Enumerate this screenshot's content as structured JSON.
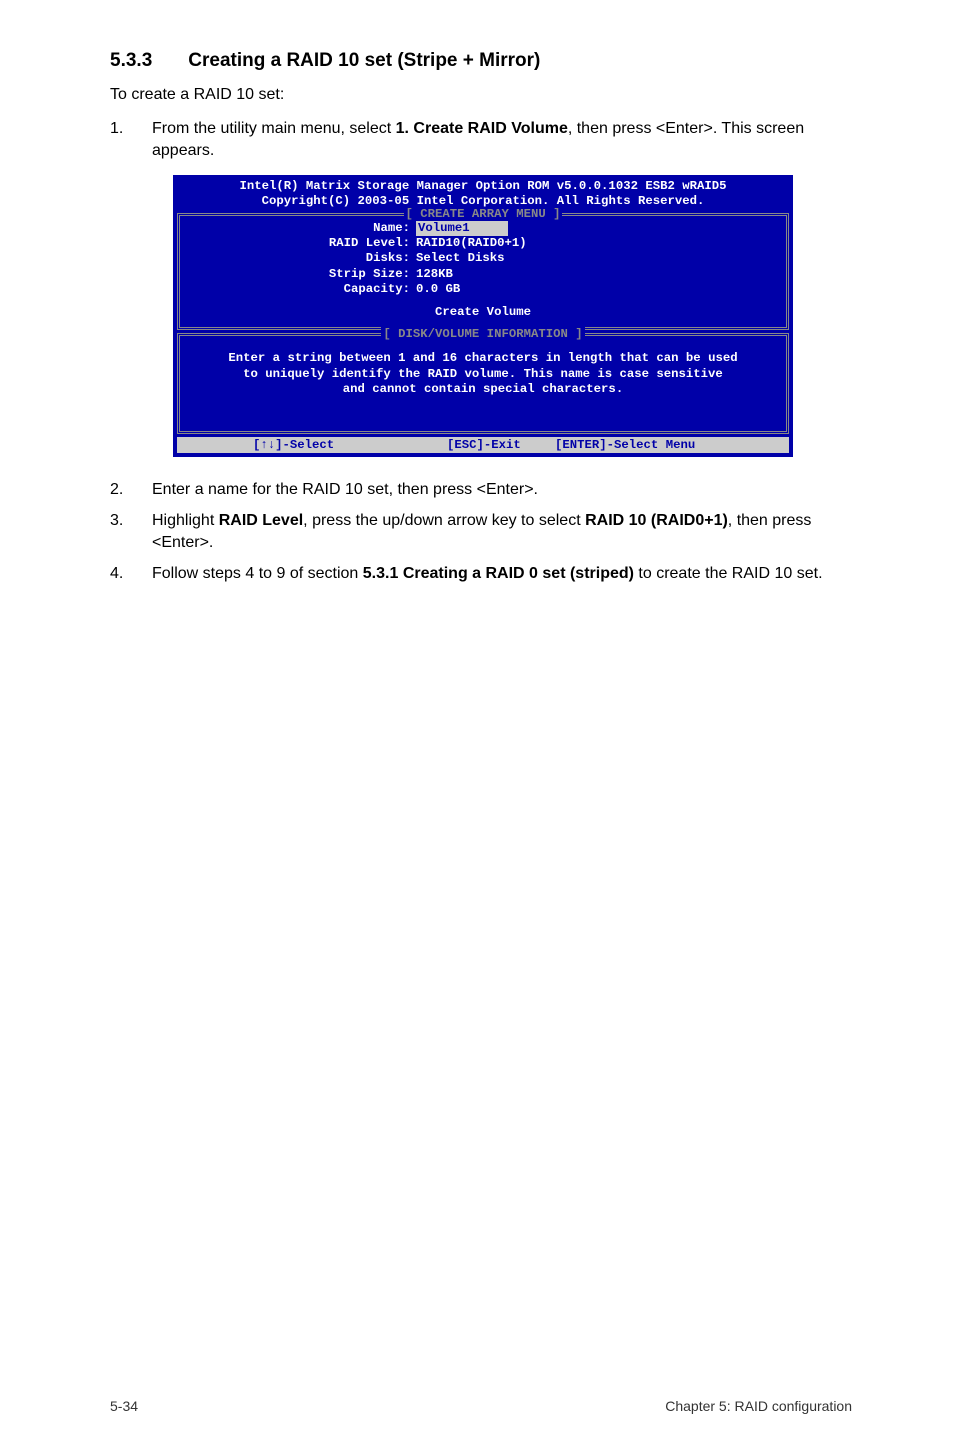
{
  "section": {
    "number": "5.3.3",
    "title": "Creating a RAID 10 set (Stripe + Mirror)"
  },
  "intro": "To create a RAID 10 set:",
  "steps": [
    {
      "num": "1.",
      "pre": "From the utility main menu, select ",
      "bold1": "1. Create RAID Volume",
      "post": ", then press <Enter>. This screen appears."
    },
    {
      "num": "2.",
      "pre": "Enter a name for the RAID 10  set, then press <Enter>.",
      "bold1": "",
      "post": ""
    },
    {
      "num": "3.",
      "pre": "Highlight ",
      "bold1": "RAID Level",
      "mid": ", press the up/down arrow key to select ",
      "bold2": "RAID 10 (RAID0+1)",
      "post": ", then press <Enter>."
    },
    {
      "num": "4.",
      "pre": "Follow steps 4 to 9 of section ",
      "bold1": "5.3.1 Creating a RAID 0 set (striped)",
      "post": " to create the RAID 10 set."
    }
  ],
  "bios": {
    "header1": "Intel(R) Matrix Storage Manager Option ROM v5.0.0.1032 ESB2 wRAID5",
    "header2": "Copyright(C) 2003-05 Intel Corporation. All Rights Reserved.",
    "frame1_title": "[ CREATE ARRAY MENU ]",
    "rows": {
      "name_label": "Name:",
      "name_value": "Volume1",
      "raid_label": "RAID Level:",
      "raid_value": "RAID10(RAID0+1)",
      "disks_label": "Disks:",
      "disks_value": "Select Disks",
      "strip_label": "Strip Size:",
      "strip_value": "128KB",
      "cap_label": "Capacity:",
      "cap_value": "0.0   GB"
    },
    "create_volume": "Create Volume",
    "frame2_title": "[ DISK/VOLUME INFORMATION ]",
    "info1": "Enter a string between 1 and 16 characters in length that can be used",
    "info2": "to uniquely identify the RAID volume. This name is case sensitive",
    "info3": "and cannot contain special characters.",
    "status_left": "[↑↓]-Select",
    "status_mid": "[ESC]-Exit",
    "status_right": "[ENTER]-Select Menu"
  },
  "footer": {
    "left": "5-34",
    "right": "Chapter 5: RAID configuration"
  }
}
